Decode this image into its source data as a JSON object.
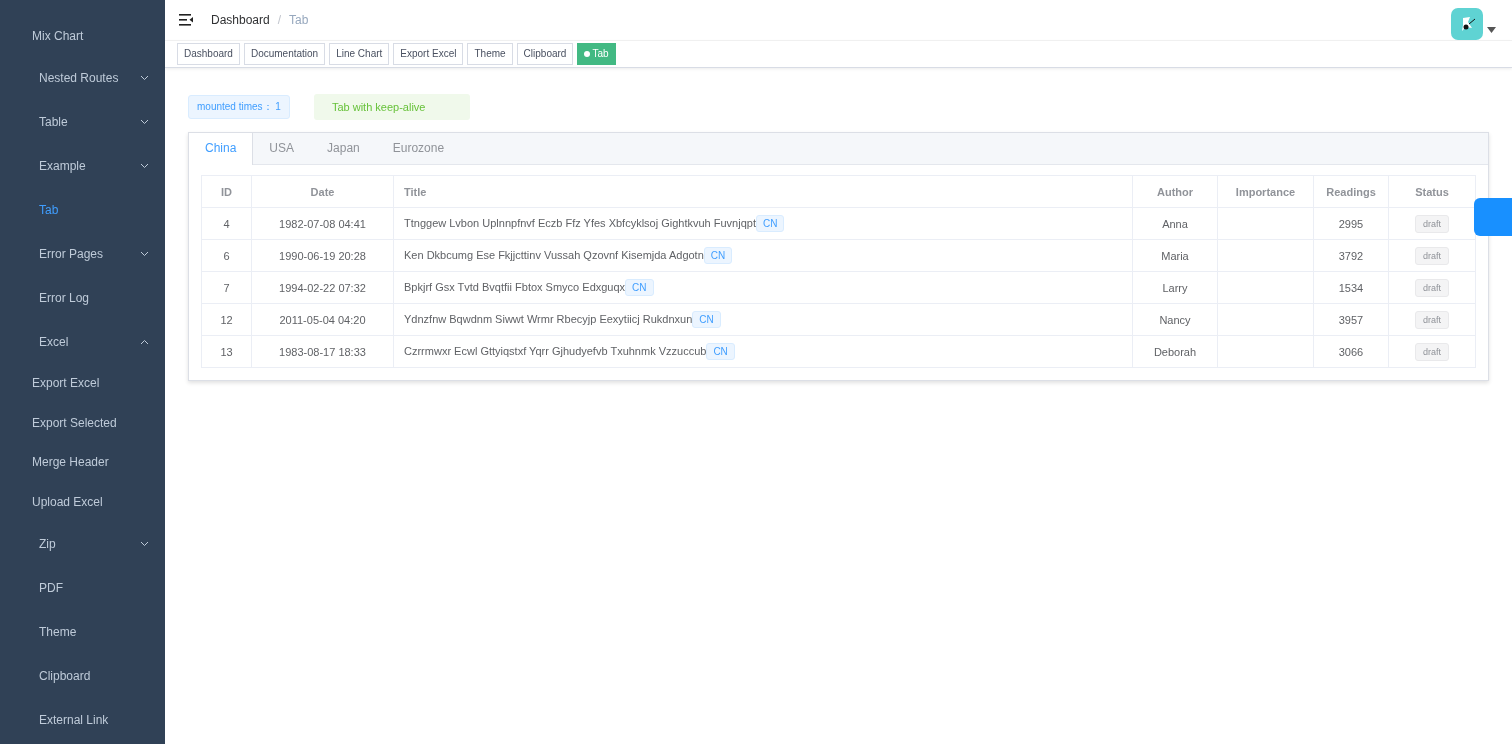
{
  "sidebar": {
    "items": [
      {
        "label": "Mix Chart",
        "kind": "link",
        "selected": false
      },
      {
        "label": "Nested Routes",
        "kind": "menu",
        "selected": false,
        "expanded": false
      },
      {
        "label": "Table",
        "kind": "menu",
        "selected": false,
        "expanded": false
      },
      {
        "label": "Example",
        "kind": "menu",
        "selected": false,
        "expanded": false
      },
      {
        "label": "Tab",
        "kind": "menu-link",
        "selected": true
      },
      {
        "label": "Error Pages",
        "kind": "menu",
        "selected": false,
        "expanded": false
      },
      {
        "label": "Error Log",
        "kind": "menu-link",
        "selected": false
      },
      {
        "label": "Excel",
        "kind": "menu",
        "selected": false,
        "expanded": true,
        "children": [
          {
            "label": "Export Excel",
            "kind": "link",
            "selected": false
          },
          {
            "label": "Export Selected",
            "kind": "link",
            "selected": false
          },
          {
            "label": "Merge Header",
            "kind": "link",
            "selected": false
          },
          {
            "label": "Upload Excel",
            "kind": "link",
            "selected": false
          }
        ]
      },
      {
        "label": "Zip",
        "kind": "menu",
        "selected": false,
        "expanded": false
      },
      {
        "label": "PDF",
        "kind": "menu-link",
        "selected": false
      },
      {
        "label": "Theme",
        "kind": "menu-link",
        "selected": false
      },
      {
        "label": "Clipboard",
        "kind": "menu-link",
        "selected": false
      },
      {
        "label": "External Link",
        "kind": "menu-link",
        "selected": false
      }
    ]
  },
  "breadcrumb": [
    "Dashboard",
    "Tab"
  ],
  "breadcrumb_separator": "/",
  "tags": [
    {
      "label": "Dashboard",
      "selected": false
    },
    {
      "label": "Documentation",
      "selected": false
    },
    {
      "label": "Line Chart",
      "selected": false
    },
    {
      "label": "Export Excel",
      "selected": false
    },
    {
      "label": "Theme",
      "selected": false
    },
    {
      "label": "Clipboard",
      "selected": false
    },
    {
      "label": "Tab",
      "selected": true
    }
  ],
  "mounted": {
    "label": "mounted times：",
    "value": "1"
  },
  "alert": "Tab with keep-alive",
  "tabs": [
    {
      "label": "China",
      "selected": true
    },
    {
      "label": "USA",
      "selected": false
    },
    {
      "label": "Japan",
      "selected": false
    },
    {
      "label": "Eurozone",
      "selected": false
    }
  ],
  "table": {
    "columns": [
      "ID",
      "Date",
      "Title",
      "Author",
      "Importance",
      "Readings",
      "Status"
    ],
    "rows": [
      {
        "id": "4",
        "date": "1982-07-08 04:41",
        "title": {
          "text": "Ttnggew Lvbon Uplnnpfnvf Eczb Ffz Yfes Xbfcyklsoj Gightkvuh Fuvnjqpt",
          "tag": "CN"
        },
        "author": "Anna",
        "readings": "2995",
        "status": "draft"
      },
      {
        "id": "6",
        "date": "1990-06-19 20:28",
        "title": {
          "text": "Ken Dkbcumg Ese Fkjjcttinv Vussah Qzovnf Kisemjda Adgotn",
          "tag": "CN"
        },
        "author": "Maria",
        "readings": "3792",
        "status": "draft"
      },
      {
        "id": "7",
        "date": "1994-02-22 07:32",
        "title": {
          "text": "Bpkjrf Gsx Tvtd Bvqtfii Fbtox Smyco Edxguqx",
          "tag": "CN"
        },
        "author": "Larry",
        "readings": "1534",
        "status": "draft"
      },
      {
        "id": "12",
        "date": "2011-05-04 04:20",
        "title": {
          "text": "Ydnzfnw Bqwdnm Siwwt Wrmr Rbecyjp Eexytiicj Rukdnxun",
          "tag": "CN"
        },
        "author": "Nancy",
        "readings": "3957",
        "status": "draft"
      },
      {
        "id": "13",
        "date": "1983-08-17 18:33",
        "title": {
          "text": "Czrrmwxr Ecwl Gttyiqstxf Yqrr Gjhudyefvb Txuhnmk Vzzuccub",
          "tag": "CN"
        },
        "author": "Deborah",
        "readings": "3066",
        "status": "draft"
      }
    ]
  }
}
